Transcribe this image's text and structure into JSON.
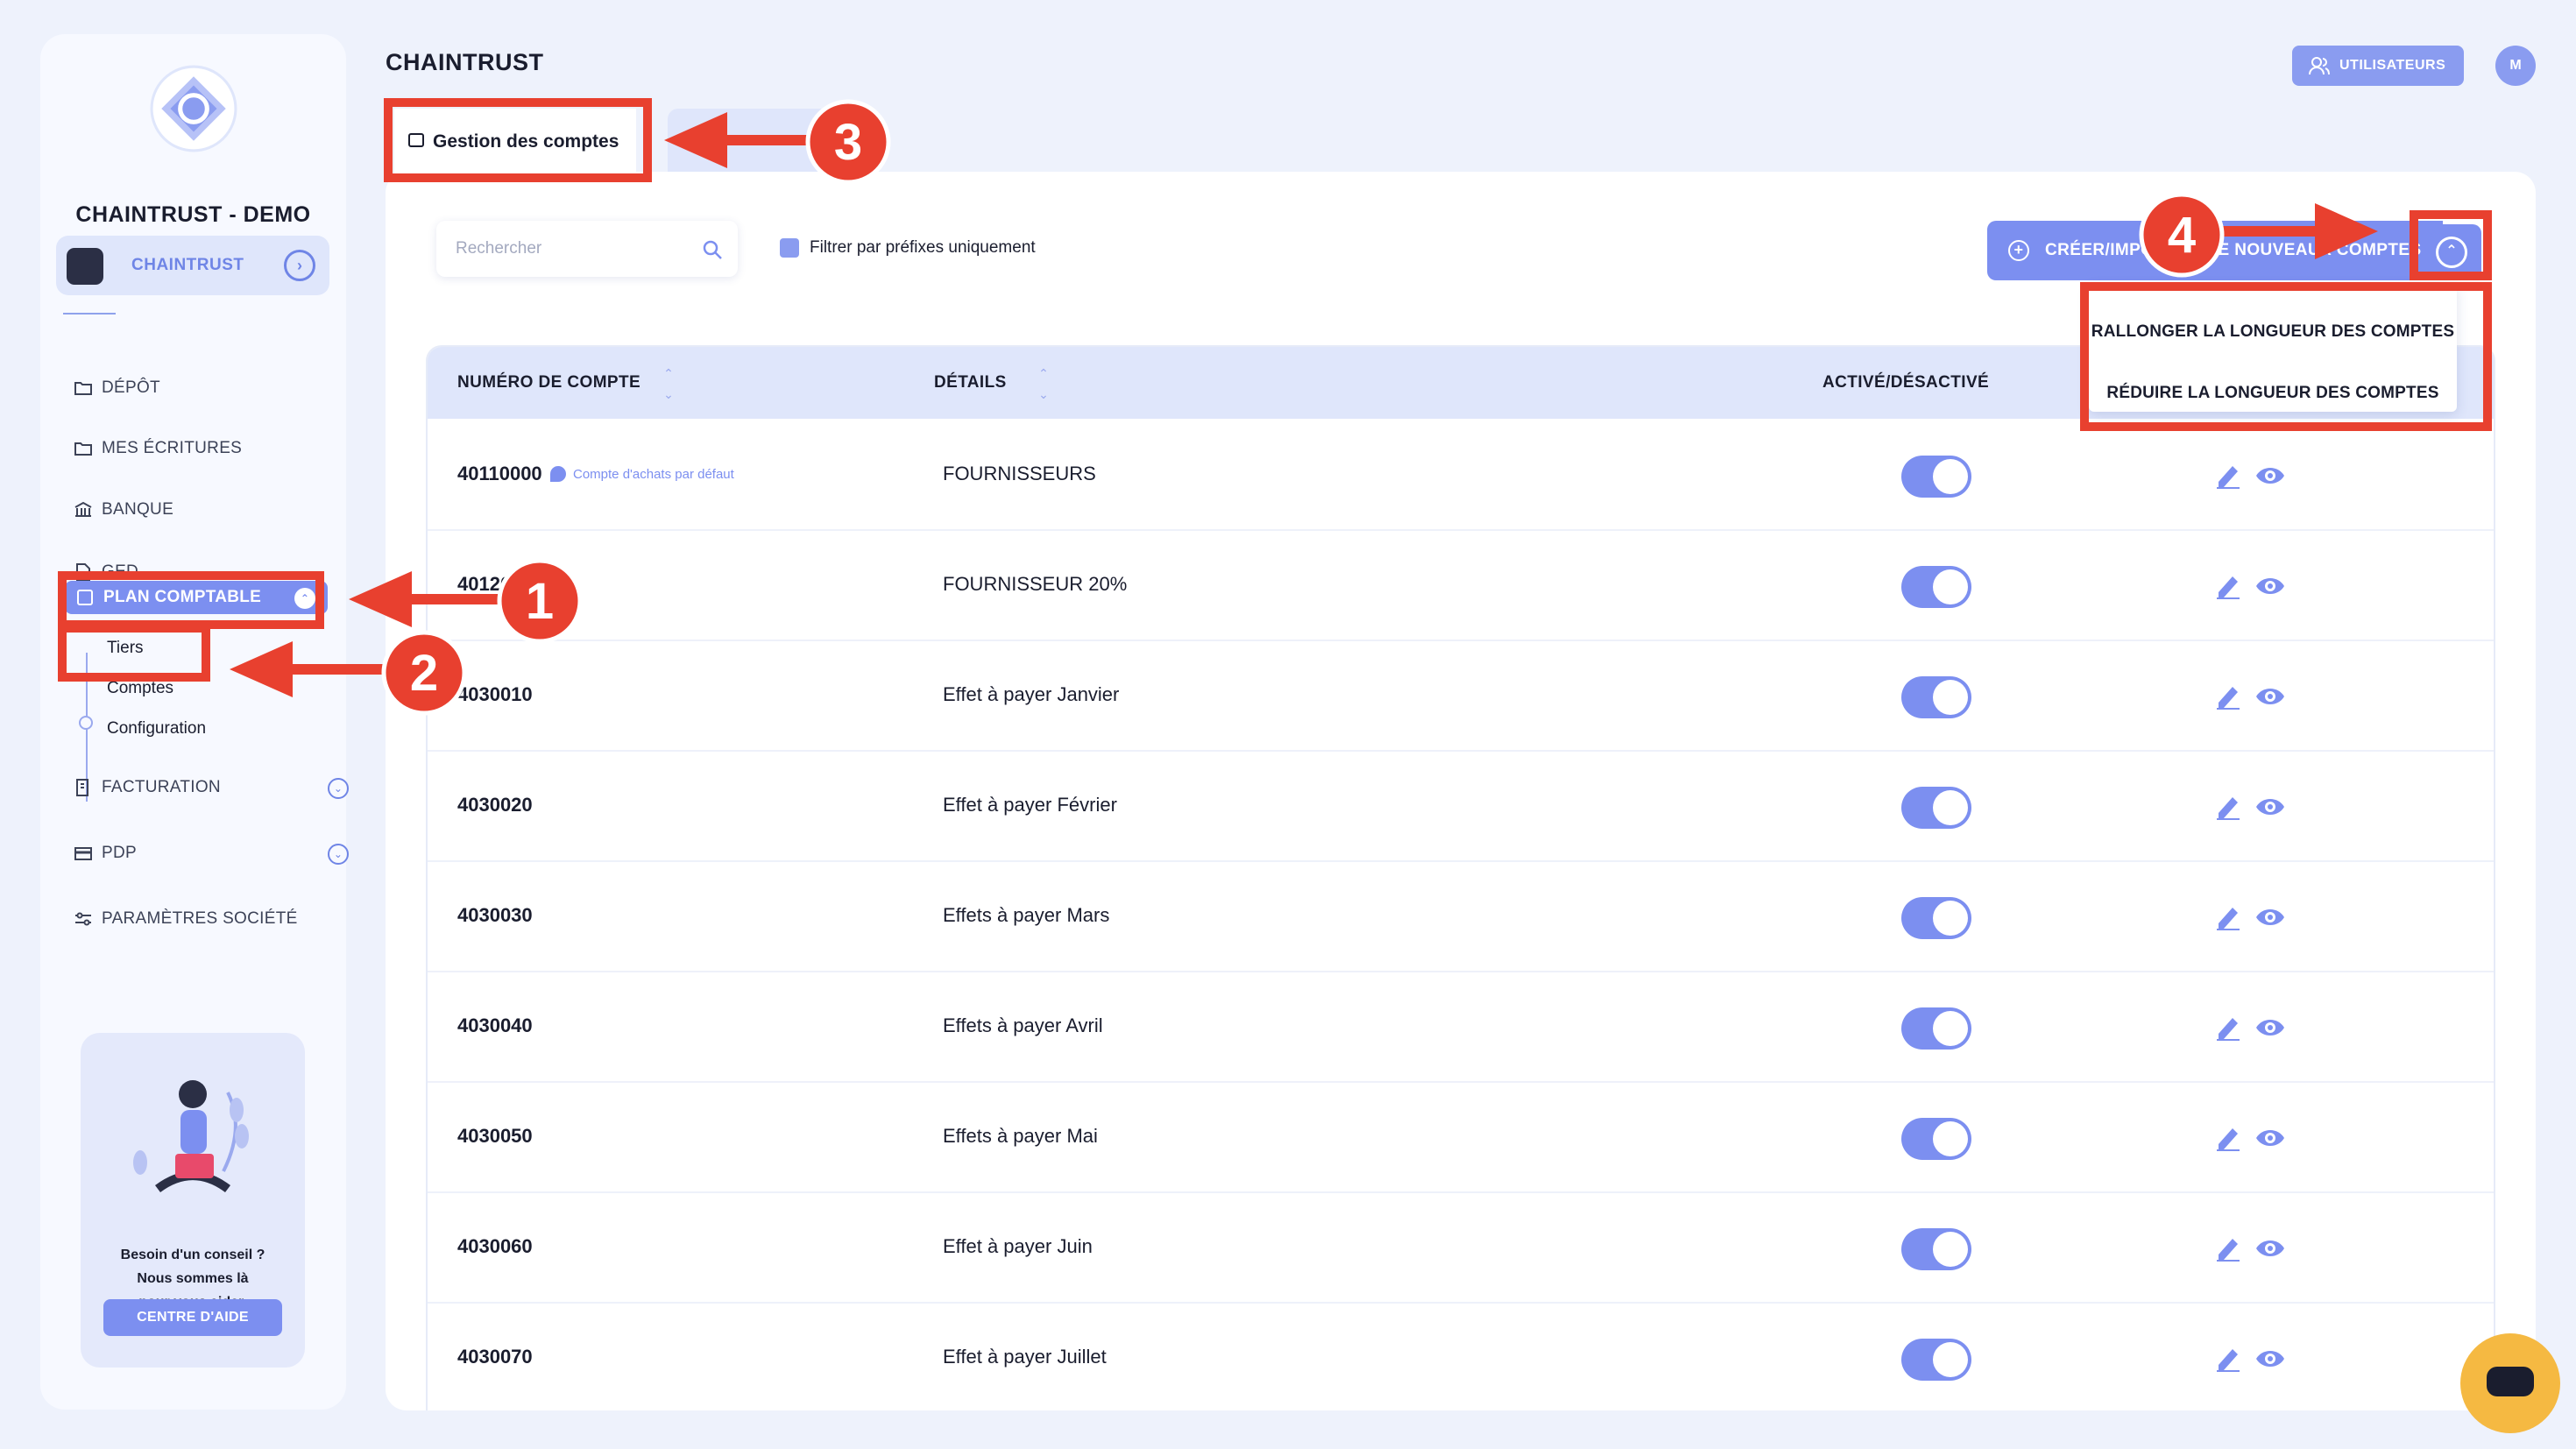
{
  "sidebar": {
    "brand": "CHAINTRUST - DEMO",
    "org_label": "CHAINTRUST",
    "items": [
      {
        "label": "DÉPÔT"
      },
      {
        "label": "MES ÉCRITURES"
      },
      {
        "label": "BANQUE"
      },
      {
        "label": "GED"
      },
      {
        "label": "PLAN COMPTABLE"
      },
      {
        "label": "FACTURATION"
      },
      {
        "label": "PDP"
      },
      {
        "label": "PARAMÈTRES SOCIÉTÉ"
      }
    ],
    "sub_items": [
      "Tiers",
      "Comptes",
      "Configuration"
    ],
    "help_line1": "Besoin d'un conseil ?",
    "help_line2": "Nous sommes là",
    "help_line3": "pour vous aider.",
    "help_button": "CENTRE D'AIDE"
  },
  "header": {
    "title": "CHAINTRUST",
    "users_button": "UTILISATEURS",
    "avatar_initial": "M"
  },
  "tabs": {
    "active": "Gestion des comptes"
  },
  "toolbar": {
    "search_placeholder": "Rechercher",
    "filter_label": "Filtrer par préfixes uniquement",
    "create_button": "CRÉER/IMPORTER DE NOUVEAUX COMPTES"
  },
  "dropdown": {
    "items": [
      "RALLONGER LA LONGUEUR DES COMPTES",
      "RÉDUIRE LA LONGUEUR DES COMPTES"
    ]
  },
  "table": {
    "headers": [
      "NUMÉRO DE COMPTE",
      "DÉTAILS",
      "ACTIVÉ/DÉSACTIVÉ"
    ],
    "rows": [
      {
        "num": "40110000",
        "badge": "Compte d'achats par défaut",
        "details": "FOURNISSEURS",
        "active": true
      },
      {
        "num": "40120",
        "badge": "",
        "details": "FOURNISSEUR 20%",
        "active": true
      },
      {
        "num": "4030010",
        "badge": "",
        "details": "Effet à payer Janvier",
        "active": true
      },
      {
        "num": "4030020",
        "badge": "",
        "details": "Effet à payer Février",
        "active": true
      },
      {
        "num": "4030030",
        "badge": "",
        "details": "Effets à payer Mars",
        "active": true
      },
      {
        "num": "4030040",
        "badge": "",
        "details": "Effets à payer Avril",
        "active": true
      },
      {
        "num": "4030050",
        "badge": "",
        "details": "Effets à payer Mai",
        "active": true
      },
      {
        "num": "4030060",
        "badge": "",
        "details": "Effet à payer Juin",
        "active": true
      },
      {
        "num": "4030070",
        "badge": "",
        "details": "Effet à payer Juillet",
        "active": true
      }
    ]
  },
  "annotations": {
    "markers": [
      "1",
      "2",
      "3",
      "4"
    ],
    "color": "#e8402f"
  },
  "colors": {
    "accent": "#7c8ff0",
    "background": "#eef2fc",
    "annotation": "#e8402f",
    "chat": "#f5b942"
  }
}
